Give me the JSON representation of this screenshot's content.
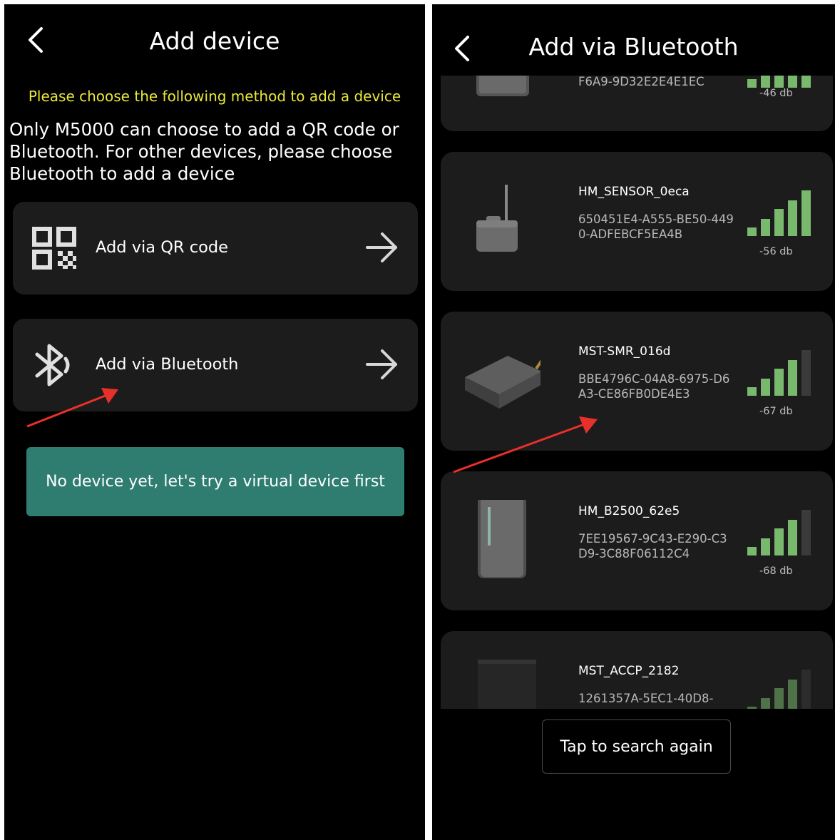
{
  "colors": {
    "screen_bg": "#000000",
    "card_bg": "#1c1c1c",
    "hint_yellow": "#e8e83a",
    "accent_teal": "#2e7d70",
    "signal_green": "#79b96e",
    "signal_gray": "#3a3a3a",
    "annotation_red": "#e8302a"
  },
  "left": {
    "title": "Add device",
    "back_icon": "chevron-left-icon",
    "hint": "Please choose the following method to add a device",
    "description": "Only M5000 can choose to add a QR code or Bluetooth. For other devices, please choose Bluetooth to add a device",
    "options": [
      {
        "label": "Add via QR code",
        "icon": "qr-code-icon"
      },
      {
        "label": "Add via Bluetooth",
        "icon": "bluetooth-icon"
      }
    ],
    "virtual_button": "No device yet, let's try a virtual device first"
  },
  "right": {
    "title": "Add via Bluetooth",
    "back_icon": "chevron-left-icon",
    "devices": [
      {
        "name": "",
        "uuid": "F6A9-9D32E2E4E1EC",
        "signal": "-46 db",
        "level": 5
      },
      {
        "name": "HM_SENSOR_0eca",
        "uuid": "650451E4-A555-BE50-4490-ADFEBCF5EA4B",
        "signal": "-56 db",
        "level": 5
      },
      {
        "name": "MST-SMR_016d",
        "uuid": "BBE4796C-04A8-6975-D6A3-CE86FB0DE4E3",
        "signal": "-67 db",
        "level": 4
      },
      {
        "name": "HM_B2500_62e5",
        "uuid": "7EE19567-9C43-E290-C3D9-3C88F06112C4",
        "signal": "-68 db",
        "level": 4
      },
      {
        "name": "MST_ACCP_2182",
        "uuid": "1261357A-5EC1-40D8-",
        "signal": "",
        "level": 4
      }
    ],
    "search_button": "Tap to search again"
  }
}
